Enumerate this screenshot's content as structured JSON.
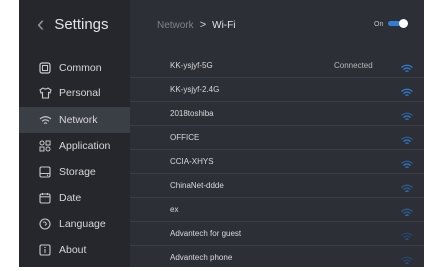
{
  "sidebar": {
    "title": "Settings",
    "back_icon": "chevron-left-icon",
    "items": [
      {
        "label": "Common",
        "icon": "square-icon"
      },
      {
        "label": "Personal",
        "icon": "shirt-icon"
      },
      {
        "label": "Network",
        "icon": "wifi-icon",
        "active": true
      },
      {
        "label": "Application",
        "icon": "apps-grid-icon"
      },
      {
        "label": "Storage",
        "icon": "storage-icon"
      },
      {
        "label": "Date",
        "icon": "calendar-icon"
      },
      {
        "label": "Language",
        "icon": "globe-icon"
      },
      {
        "label": "About",
        "icon": "info-icon"
      }
    ]
  },
  "header": {
    "breadcrumb_parent": "Network",
    "breadcrumb_separator": ">",
    "breadcrumb_current": "Wi-Fi",
    "toggle_label": "On",
    "toggle_on": true,
    "accent_color": "#2f7fd8"
  },
  "networks": [
    {
      "ssid": "KK-ysjyf-5G",
      "status": "Connected",
      "signal": "strong"
    },
    {
      "ssid": "KK-ysjyf-2.4G",
      "status": "",
      "signal": "strong"
    },
    {
      "ssid": "2018toshiba",
      "status": "",
      "signal": "medium"
    },
    {
      "ssid": "OFFICE",
      "status": "",
      "signal": "medium"
    },
    {
      "ssid": "CCIA-XHYS",
      "status": "",
      "signal": "medium"
    },
    {
      "ssid": "ChinaNet-ddde",
      "status": "",
      "signal": "weak"
    },
    {
      "ssid": "ex",
      "status": "",
      "signal": "weak"
    },
    {
      "ssid": "Advantech for guest",
      "status": "",
      "signal": "very-weak"
    },
    {
      "ssid": "Advantech phone",
      "status": "",
      "signal": "very-weak"
    }
  ]
}
